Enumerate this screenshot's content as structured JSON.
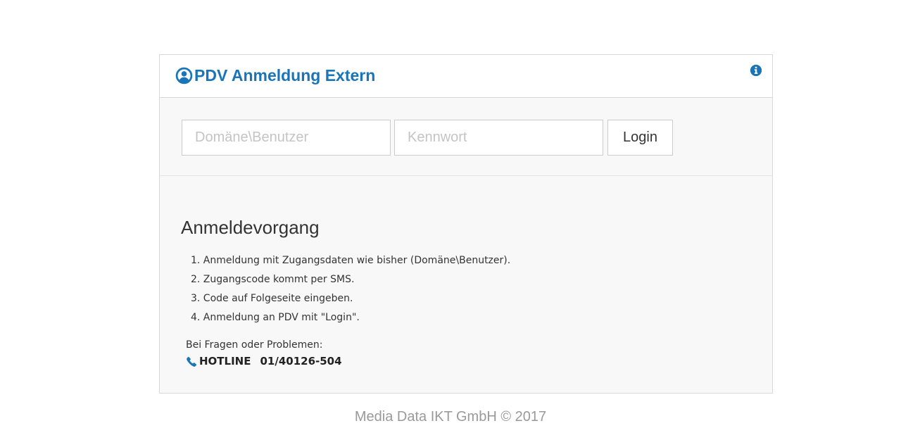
{
  "header": {
    "title": "PDV Anmeldung Extern",
    "user_icon": "user-circle-icon",
    "info_icon": "info-circle-icon",
    "accent_color": "#1a75b8"
  },
  "login": {
    "username_placeholder": "Domäne\\Benutzer",
    "username_value": "",
    "password_placeholder": "Kennwort",
    "password_value": "",
    "login_label": "Login"
  },
  "info": {
    "heading": "Anmeldevorgang",
    "steps": [
      "1. Anmeldung mit Zugangsdaten wie bisher (Domäne\\Benutzer).",
      "2. Zugangscode kommt per SMS.",
      "3. Code auf Folgeseite eingeben.",
      "4. Anmeldung an PDV mit \"Login\"."
    ],
    "help_text": "Bei Fragen oder Problemen:",
    "phone_icon": "phone-icon",
    "hotline_label": "HOTLINE",
    "hotline_number": "01/40126-504"
  },
  "footer": {
    "text": "Media Data IKT GmbH © 2017"
  }
}
